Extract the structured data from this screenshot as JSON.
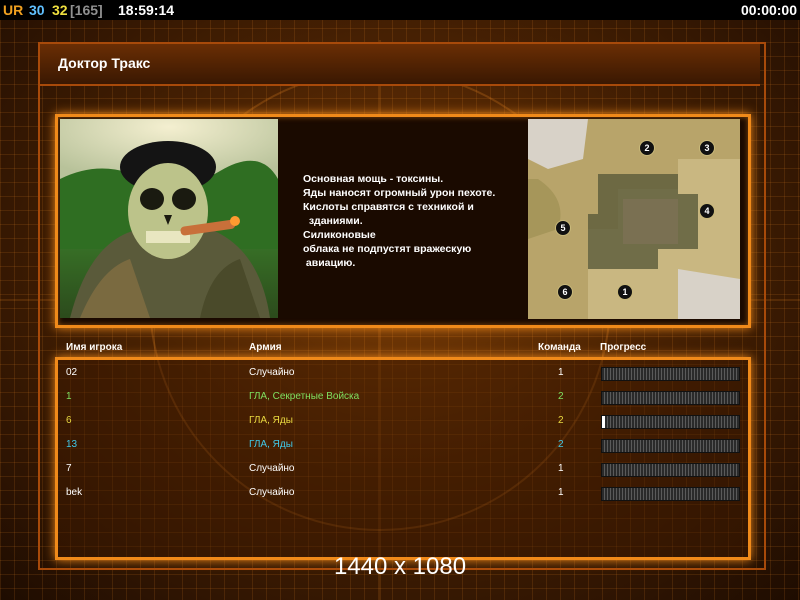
{
  "topbar": {
    "ur_label": "UR",
    "fps": "30",
    "fps2": "32",
    "bracket_value": "[165]",
    "clock": "18:59:14",
    "timer": "00:00:00"
  },
  "title": "Доктор Тракс",
  "description_lines": [
    "Основная мощь - токсины.",
    "Яды наносят огромный урон пехоте.",
    "Кислоты справятся с техникой и",
    "  зданиями.",
    "Силиконовые",
    "облака не подпустят вражескую",
    " авиацию."
  ],
  "minimap": {
    "spawns": [
      "1",
      "2",
      "3",
      "4",
      "5",
      "6"
    ]
  },
  "columns": {
    "player": "Имя игрока",
    "army": "Армия",
    "team": "Команда",
    "progress": "Прогресс"
  },
  "players": [
    {
      "name": "02",
      "army": "Случайно",
      "team": "1",
      "color": "#ffffff",
      "progress": 0
    },
    {
      "name": "1",
      "army": "ГЛА, Секретные Войска",
      "team": "2",
      "color": "#7fe060",
      "progress": 0
    },
    {
      "name": "6",
      "army": "ГЛА, Яды",
      "team": "2",
      "color": "#e8d840",
      "progress": 0.02
    },
    {
      "name": "13",
      "army": "ГЛА, Яды",
      "team": "2",
      "color": "#40c8e8",
      "progress": 0
    },
    {
      "name": "7",
      "army": "Случайно",
      "team": "1",
      "color": "#ffffff",
      "progress": 0
    },
    {
      "name": "bek",
      "army": "Случайно",
      "team": "1",
      "color": "#ffffff",
      "progress": 0
    }
  ],
  "resolution": "1440 x 1080",
  "colors": {
    "accent": "#f08a1a",
    "frame": "#a84a0a"
  }
}
